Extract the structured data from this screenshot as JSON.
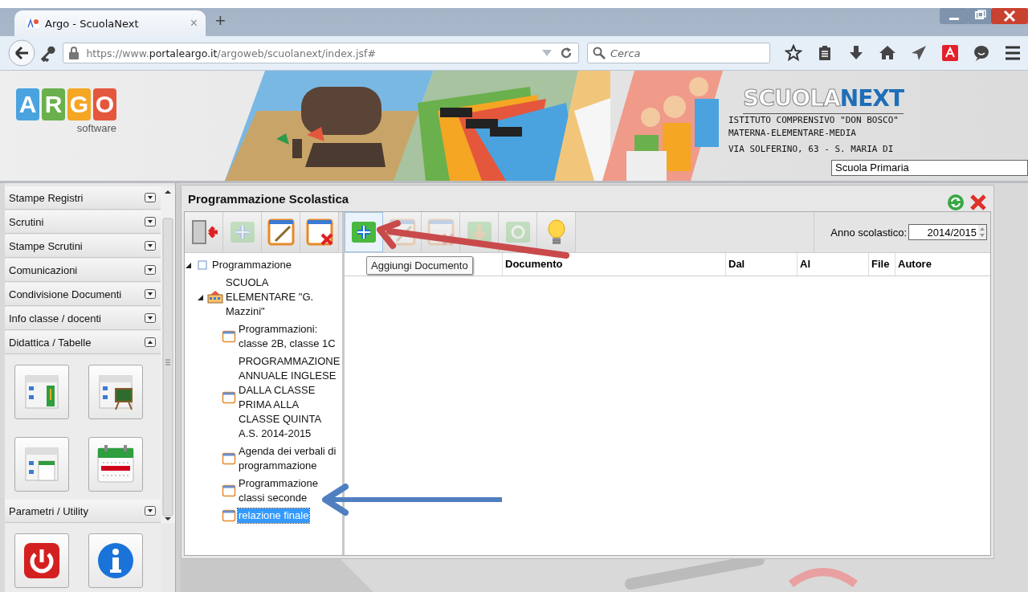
{
  "browser": {
    "tab_title": "Argo - ScuolaNext",
    "tab_close": "×",
    "new_tab": "+",
    "url_prefix": "https://www.",
    "url_domain": "portaleargo.it",
    "url_path": "/argoweb/scuolanext/index.jsf#",
    "search": {
      "placeholder": "Cerca"
    }
  },
  "header": {
    "logo_letters": [
      {
        "text": "A",
        "color": "#4aa3df"
      },
      {
        "text": "R",
        "color": "#6ab04c"
      },
      {
        "text": "G",
        "color": "#f5a623"
      },
      {
        "text": "O",
        "color": "#e4573d"
      }
    ],
    "logo_sub": "software",
    "brand": [
      "SCUOLA",
      "NEXT"
    ],
    "school_lines": [
      "ISTITUTO COMPRENSIVO \"DON BOSCO\"",
      "MATERNA-ELEMENTARE-MEDIA",
      "VIA SOLFERINO, 63 - S. MARIA DI"
    ],
    "school_select": "Scuola Primaria"
  },
  "sidebar": {
    "sections": [
      {
        "label": "Stampe Registri",
        "expanded": false
      },
      {
        "label": "Scrutini",
        "expanded": false
      },
      {
        "label": "Stampe Scrutini",
        "expanded": false
      },
      {
        "label": "Comunicazioni",
        "expanded": false
      },
      {
        "label": "Condivisione Documenti",
        "expanded": false
      },
      {
        "label": "Info classe / docenti",
        "expanded": false
      },
      {
        "label": "Didattica / Tabelle",
        "expanded": true,
        "tiles": [
          {
            "kind": "register"
          },
          {
            "kind": "board"
          },
          {
            "kind": "schedule"
          },
          {
            "kind": "calendar"
          }
        ]
      },
      {
        "label": "Parametri / Utility",
        "expanded": false,
        "tiles": [
          {
            "kind": "power"
          },
          {
            "kind": "info"
          }
        ]
      }
    ]
  },
  "panel": {
    "title": "Programmazione Scolastica",
    "tree_tools": [
      {
        "kind": "exit",
        "disabled": false
      },
      {
        "kind": "add",
        "disabled": true
      },
      {
        "kind": "edit",
        "disabled": false
      },
      {
        "kind": "delete",
        "disabled": false
      }
    ],
    "doc_tools": [
      {
        "kind": "add",
        "disabled": false
      },
      {
        "kind": "edit",
        "disabled": true
      },
      {
        "kind": "delete",
        "disabled": true
      },
      {
        "kind": "download",
        "disabled": true
      },
      {
        "kind": "share",
        "disabled": true
      },
      {
        "kind": "bulb",
        "disabled": false
      }
    ],
    "year_label": "Anno scolastico:",
    "year_value": "2014/2015",
    "tooltip": "Aggiungi Documento",
    "columns": [
      "Documento",
      "Dal",
      "Al",
      "File",
      "Autore"
    ],
    "tree": {
      "label": "Programmazione",
      "expanded": true,
      "children": [
        {
          "label": "SCUOLA ELEMENTARE \"G. Mazzini\"",
          "kind": "school",
          "expanded": true,
          "children": [
            {
              "label": "Programmazioni: classe 2B, classe 1C",
              "selected": false
            },
            {
              "label": "PROGRAMMAZIONE ANNUALE INGLESE DALLA CLASSE PRIMA ALLA CLASSE QUINTA A.S. 2014-2015",
              "selected": false
            },
            {
              "label": "Agenda dei verbali di programmazione",
              "selected": false
            },
            {
              "label": "Programmazione classi seconde",
              "selected": false
            },
            {
              "label": "relazione finale",
              "selected": true
            }
          ]
        }
      ]
    }
  }
}
